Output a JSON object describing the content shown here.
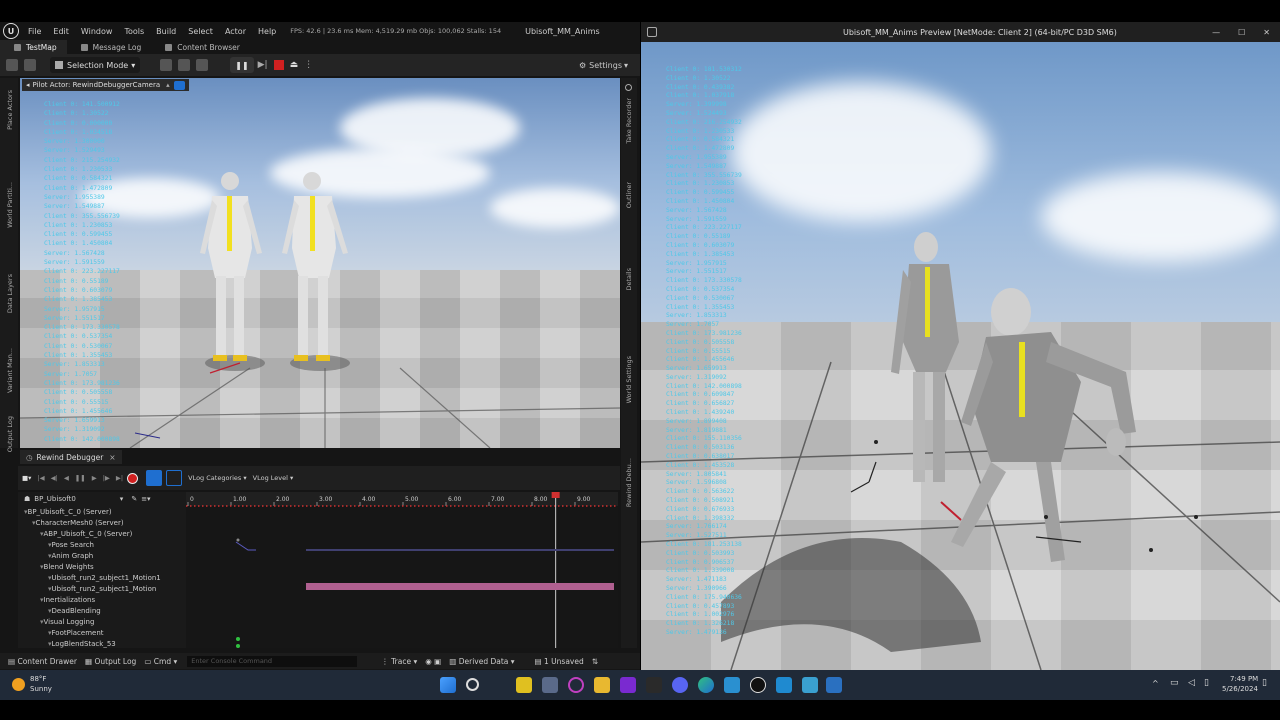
{
  "editor": {
    "menu": [
      "File",
      "Edit",
      "Window",
      "Tools",
      "Build",
      "Select",
      "Actor",
      "Help"
    ],
    "stats": "FPS: 42.6  |  23.6 ms  Mem: 4,519.29 mb  Objs: 100,062  Stalls: 154",
    "title": "Ubisoft_MM_Anims",
    "tabs": {
      "level": "TestMap",
      "log": "Message Log",
      "browser": "Content Browser"
    },
    "selection_mode": "Selection Mode",
    "settings": "Settings",
    "pilot_label": "Pilot Actor: RewindDebuggerCamera",
    "side_left": [
      "Place Actors",
      "World Partiti...",
      "Data Layers",
      "Variant Man...",
      "Output Log"
    ],
    "side_right": [
      "Take Recorder",
      "Outliner",
      "Details",
      "World Settings",
      "Rewind Debu..."
    ]
  },
  "debug_lines_left": [
    "Client 0: 141.500912",
    "Client 0: 1.30522",
    "Client 0: 0.000000",
    "Client 0: 1.034518",
    "Server: 1.300000",
    "Server: 1.529493",
    "Client 0: 215.254932",
    "Client 0: 1.230533",
    "Client 0: 0.584321",
    "Client 0: 1.472809",
    "Server: 1.955389",
    "Server: 1.549887",
    "Client 0: 355.556739",
    "Client 0: 1.230853",
    "Client 0: 0.599455",
    "Client 0: 1.450804",
    "Server: 1.567428",
    "Server: 1.591559",
    "Client 0: 223.227117",
    "Client 0: 0.55189",
    "Client 0: 0.603079",
    "Client 0: 1.385453",
    "Server: 1.957915",
    "Server: 1.551517",
    "Client 0: 173.330578",
    "Client 0: 0.537354",
    "Client 0: 0.530067",
    "Client 0: 1.355453",
    "Server: 1.853313",
    "Server: 1.7057",
    "Client 0: 173.981236",
    "Client 0: 0.505558",
    "Client 0: 0.55515",
    "Client 0: 1.455646",
    "Server: 1.659913",
    "Server: 1.319092",
    "Client 0: 142.000898"
  ],
  "debug_lines_right": [
    "Client 0: 181.530312",
    "Client 0: 1.30522",
    "Client 0: 0.439382",
    "Client 0: 1.037918",
    "Server: 1.399998",
    "Server: 1.524493",
    "Client 0: 216.254932",
    "Client 0: 1.230533",
    "Client 0: 0.584321",
    "Client 0: 1.472809",
    "Server: 1.955389",
    "Server: 1.549887",
    "Client 0: 355.556739",
    "Client 0: 1.230853",
    "Client 0: 0.599455",
    "Client 0: 1.450804",
    "Server: 1.567428",
    "Server: 1.591559",
    "Client 0: 223.227117",
    "Client 0: 0.55189",
    "Client 0: 0.603079",
    "Client 0: 1.385453",
    "Server: 1.957915",
    "Server: 1.551517",
    "Client 0: 173.330578",
    "Client 0: 0.537354",
    "Client 0: 0.530067",
    "Client 0: 1.355453",
    "Server: 1.853313",
    "Server: 1.7057",
    "Client 0: 173.981236",
    "Client 0: 0.505558",
    "Client 0: 0.55515",
    "Client 0: 1.455646",
    "Server: 1.659913",
    "Server: 1.319092",
    "Client 0: 142.000898",
    "Client 0: 0.609847",
    "Client 0: 0.656827",
    "Client 0: 1.439240",
    "Server: 1.899408",
    "Server: 1.819881",
    "Client 0: 155.110356",
    "Client 0: 0.503136",
    "Client 0: 0.638017",
    "Client 0: 1.453528",
    "Server: 1.805841",
    "Server: 1.596808",
    "Client 0: 0.563622",
    "Client 0: 0.508921",
    "Client 0: 0.676933",
    "Client 0: 1.398332",
    "Server: 1.766174",
    "Server: 1.527511",
    "Client 0: 181.253138",
    "Client 0: 0.503993",
    "Client 0: 0.906537",
    "Client 0: 1.339008",
    "Server: 1.471183",
    "Server: 1.390966",
    "Client 0: 175.940636",
    "Client 0: 0.457893",
    "Client 0: 1.002976",
    "Client 0: 1.326218",
    "Server: 1.479136"
  ],
  "rewind": {
    "tab": "Rewind Debugger",
    "vlog_categories": "VLog Categories",
    "vlog_level": "VLog Level",
    "actor": "BP_Ubisoft0",
    "tree": [
      {
        "label": "BP_Ubisoft_C_0 (Server)",
        "indent": 0
      },
      {
        "label": "CharacterMesh0 (Server)",
        "indent": 1
      },
      {
        "label": "ABP_Ubisoft_C_0 (Server)",
        "indent": 2
      },
      {
        "label": "Pose Search",
        "indent": 3
      },
      {
        "label": "Anim Graph",
        "indent": 3
      },
      {
        "label": "Blend Weights",
        "indent": 2
      },
      {
        "label": "Ubisoft_run2_subject1_Motion1",
        "indent": 3
      },
      {
        "label": "Ubisoft_run2_subject1_Motion",
        "indent": 3
      },
      {
        "label": "Inertializations",
        "indent": 2
      },
      {
        "label": "DeadBlending",
        "indent": 3
      },
      {
        "label": "Visual Logging",
        "indent": 2
      },
      {
        "label": "FootPlacement",
        "indent": 3
      },
      {
        "label": "LogBlendStack_53",
        "indent": 3
      }
    ],
    "ruler": [
      "0",
      "1.00",
      "2.00",
      "3.00",
      "4.00",
      "5.00",
      "6.00",
      "7.00",
      "8.00",
      "9.00"
    ],
    "playhead_value": 9.0
  },
  "bottom": {
    "content_drawer": "Content Drawer",
    "output_log": "Output Log",
    "cmd": "Cmd",
    "console_placeholder": "Enter Console Command",
    "trace": "Trace",
    "derived": "Derived Data",
    "unsaved": "1 Unsaved"
  },
  "preview": {
    "title": "Ubisoft_MM_Anims Preview [NetMode: Client 2]  (64-bit/PC D3D SM6)"
  },
  "taskbar": {
    "temp": "88°F",
    "weather": "Sunny",
    "time": "7:49 PM",
    "date": "5/26/2024"
  },
  "colors": {
    "accent": "#1f6fd0",
    "debug_text": "#4fc8e8",
    "record": "#d02020"
  }
}
